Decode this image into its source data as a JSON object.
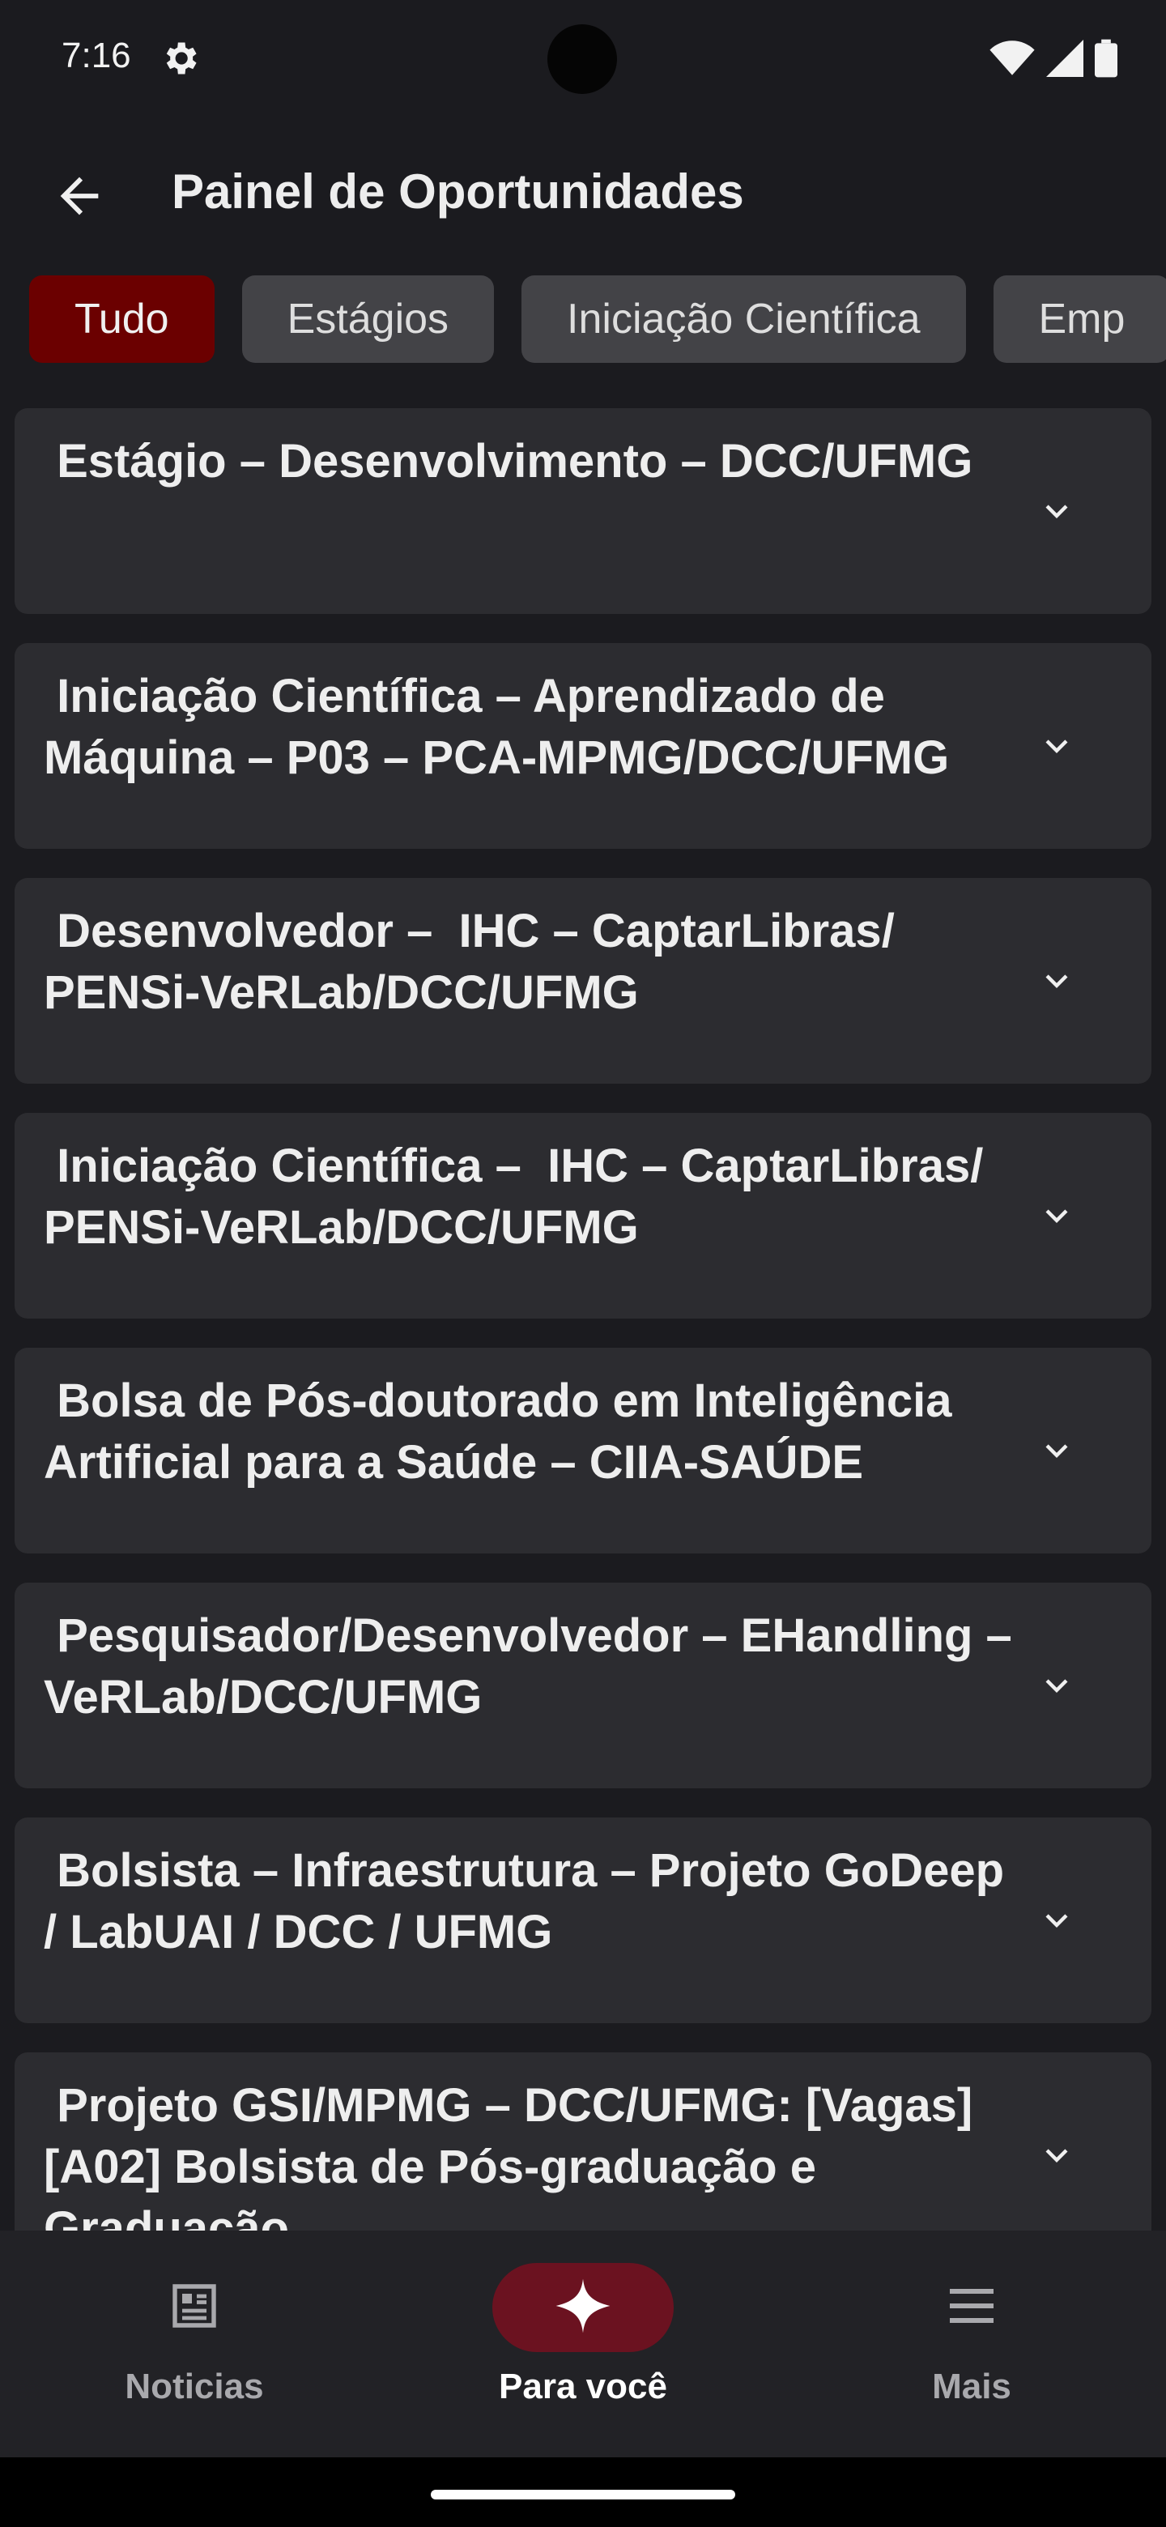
{
  "status_bar": {
    "time": "7:16",
    "icons": [
      "gear-icon",
      "wifi-icon",
      "signal-icon",
      "battery-icon"
    ]
  },
  "app_bar": {
    "title": "Painel de Oportunidades",
    "back_icon": "arrow-back-icon"
  },
  "chips": [
    {
      "label": "Tudo",
      "active": true
    },
    {
      "label": "Estágios",
      "active": false
    },
    {
      "label": "Iniciação Científica",
      "active": false
    },
    {
      "label": "Emp",
      "active": false
    }
  ],
  "cards": [
    {
      "title": " Estágio – Desenvolvimento – DCC/UFMG"
    },
    {
      "title": " Iniciação Científica – Aprendizado de Máquina – P03 – PCA-MPMG/DCC/UFMG"
    },
    {
      "title": " Desenvolvedor –  IHC – CaptarLibras/ PENSi-VeRLab/DCC/UFMG"
    },
    {
      "title": " Iniciação Científica –  IHC – CaptarLibras/ PENSi-VeRLab/DCC/UFMG"
    },
    {
      "title": " Bolsa de Pós-doutorado em Inteligência Artificial para a Saúde – CIIA-SAÚDE"
    },
    {
      "title": " Pesquisador/Desenvolvedor – EHandling – VeRLab/DCC/UFMG"
    },
    {
      "title": " Bolsista – Infraestrutura – Projeto GoDeep / LabUAI / DCC / UFMG"
    },
    {
      "title": " Projeto GSI/MPMG – DCC/UFMG: [Vagas] [A02] Bolsista de Pós-graduação e Graduação"
    }
  ],
  "bottom_nav": {
    "items": [
      {
        "label": "Noticias",
        "icon": "news-icon",
        "active": false
      },
      {
        "label": "Para você",
        "icon": "sparkle-icon",
        "active": true
      },
      {
        "label": "Mais",
        "icon": "menu-icon",
        "active": false
      }
    ]
  },
  "colors": {
    "background": "#1b1b1f",
    "card": "#2c2c30",
    "chip": "#434347",
    "accent": "#6b0000",
    "nav_active_pill": "#6b1220"
  }
}
